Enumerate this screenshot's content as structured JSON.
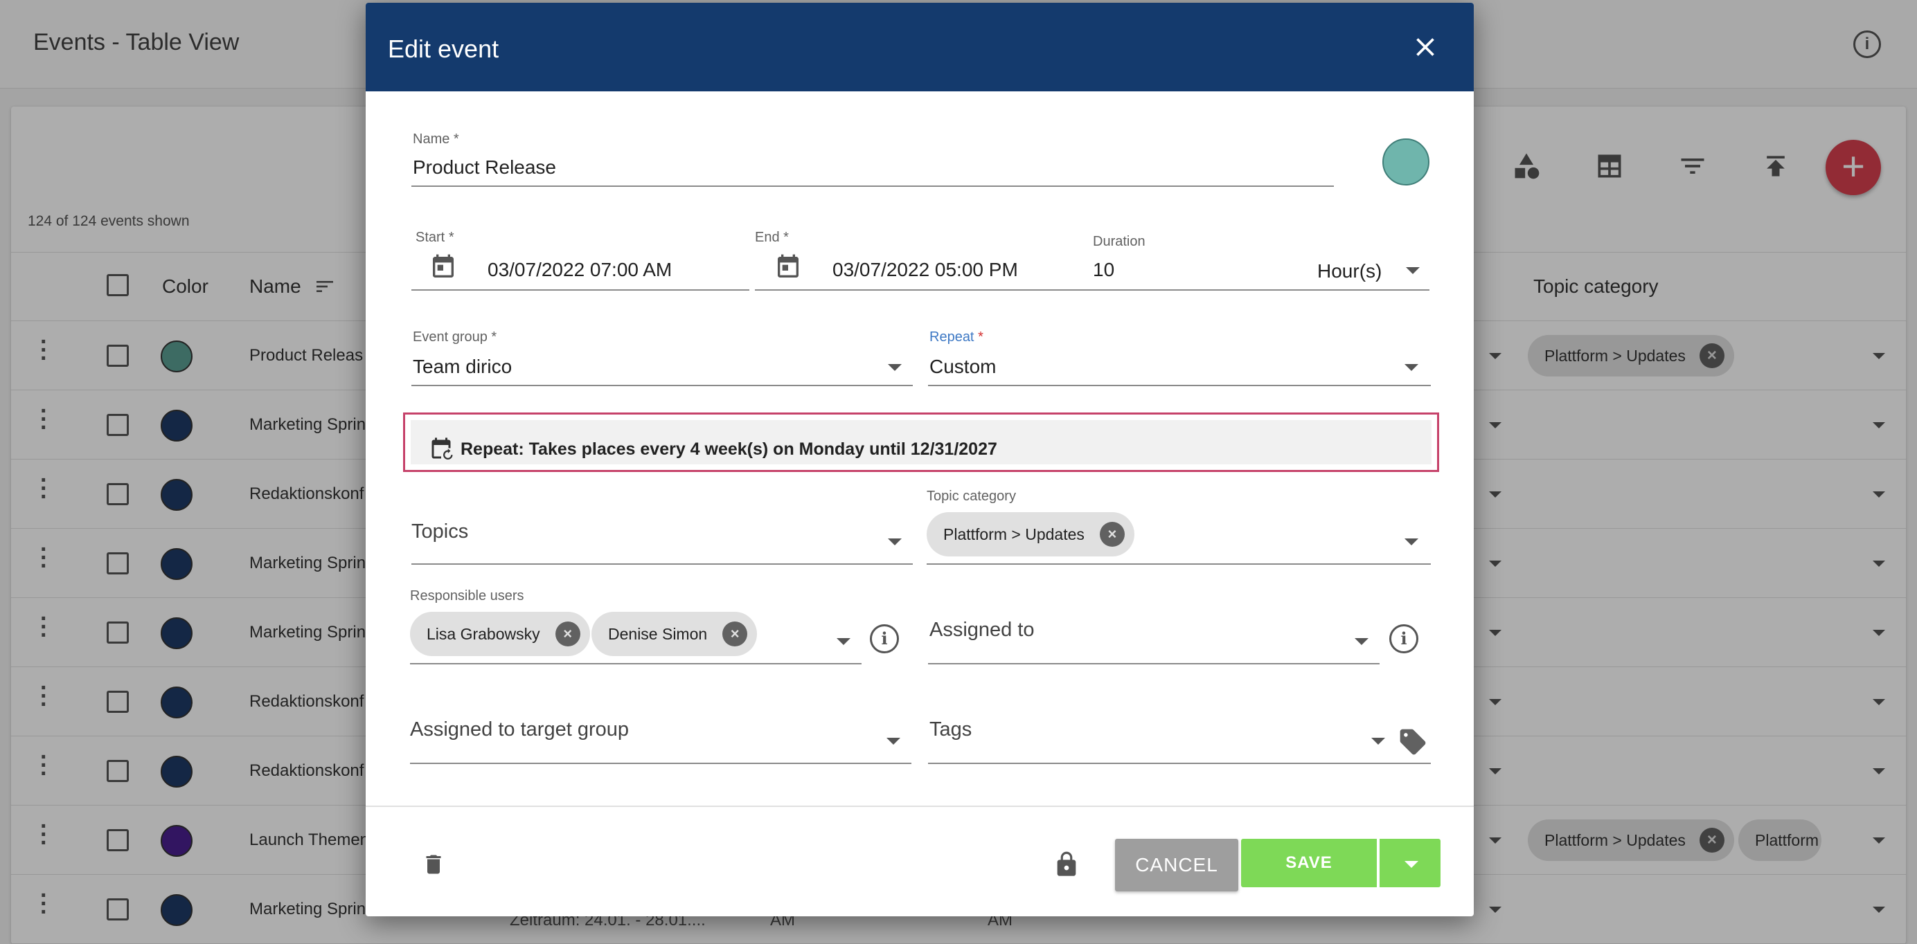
{
  "background": {
    "page_title": "Events - Table View",
    "events_count": "124 of 124 events shown",
    "columns": {
      "color": "Color",
      "name": "Name",
      "topic_category": "Topic category"
    },
    "rows": [
      {
        "name": "Product Releas",
        "color": "#5a9e92",
        "topic_chips": [
          "Plattform > Updates"
        ]
      },
      {
        "name": "Marketing Sprin",
        "color": "#1e3a66",
        "topic_chips": []
      },
      {
        "name": "Redaktionskonf",
        "color": "#1e3a66",
        "topic_chips": []
      },
      {
        "name": "Marketing Sprin",
        "color": "#1e3a66",
        "topic_chips": []
      },
      {
        "name": "Marketing Sprin",
        "color": "#1e3a66",
        "topic_chips": []
      },
      {
        "name": "Redaktionskonf",
        "color": "#1e3a66",
        "topic_chips": []
      },
      {
        "name": "Redaktionskonf",
        "color": "#1e3a66",
        "topic_chips": []
      },
      {
        "name": "Launch Themen",
        "color": "#4a2090",
        "topic_chips": [
          "Plattform > Updates",
          "Plattform"
        ]
      },
      {
        "name": "Marketing Sprin",
        "color": "#1e3a66",
        "topic_chips": []
      }
    ],
    "footer_fragments": {
      "period": "Zeitraum: 24.01. - 28.01....",
      "am1": "AM",
      "am2": "AM"
    }
  },
  "dialog": {
    "title": "Edit event",
    "name": {
      "label": "Name",
      "required": "*",
      "value": "Product Release"
    },
    "color": "#6fb5ac",
    "start": {
      "label": "Start",
      "required": "*",
      "value": "03/07/2022 07:00 AM"
    },
    "end": {
      "label": "End",
      "required": "*",
      "value": "03/07/2022 05:00 PM"
    },
    "duration": {
      "label": "Duration",
      "value": "10",
      "unit": "Hour(s)"
    },
    "event_group": {
      "label": "Event group",
      "required": "*",
      "value": "Team dirico"
    },
    "repeat": {
      "label": "Repeat",
      "required": "*",
      "value": "Custom"
    },
    "repeat_summary": "Repeat: Takes places every 4 week(s) on Monday until 12/31/2027",
    "topics": {
      "label": "Topics"
    },
    "topic_category": {
      "label": "Topic category",
      "chips": [
        "Plattform > Updates"
      ]
    },
    "responsible_users": {
      "label": "Responsible users",
      "chips": [
        "Lisa Grabowsky",
        "Denise Simon"
      ]
    },
    "assigned_to": {
      "label": "Assigned to"
    },
    "assigned_to_target_group": {
      "label": "Assigned to target group"
    },
    "tags": {
      "label": "Tags"
    },
    "buttons": {
      "cancel": "CANCEL",
      "save": "SAVE"
    }
  }
}
